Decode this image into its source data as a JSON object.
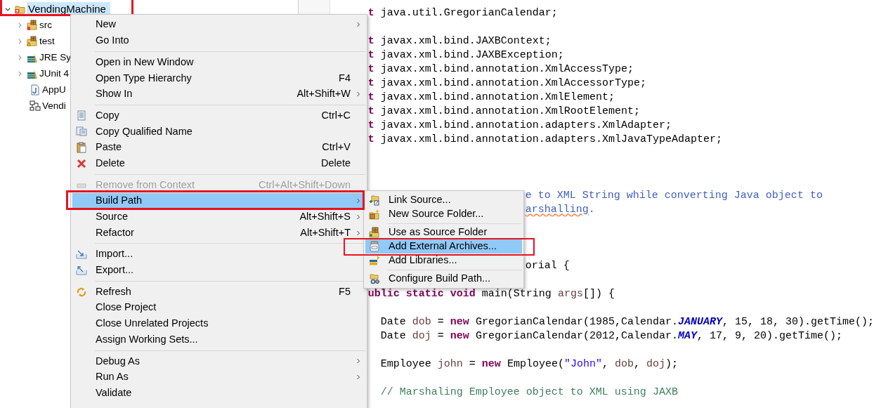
{
  "tree": [
    {
      "label": "VendingMachine",
      "expanded": true,
      "selected": true,
      "children": [
        {
          "label": "src",
          "expandable": true,
          "selected": false
        },
        {
          "label": "test",
          "expandable": true,
          "selected": false
        },
        {
          "label": "JRE Sy",
          "expandable": true,
          "selected": false
        },
        {
          "label": "JUnit 4",
          "expandable": true,
          "selected": false
        },
        {
          "label": "AppU",
          "expandable": false,
          "selected": false
        },
        {
          "label": "Vendi",
          "expandable": false,
          "selected": false
        }
      ]
    }
  ],
  "editor": {
    "lines": [
      {
        "kind": "code",
        "indented": false,
        "segments": [
          {
            "text": "t",
            "kind": "keyword"
          },
          {
            "text": " java.util.GregorianCalendar;",
            "kind": "plain"
          }
        ]
      },
      {
        "kind": "blank"
      },
      {
        "kind": "code",
        "indented": false,
        "segments": [
          {
            "text": "t",
            "kind": "keyword"
          },
          {
            "text": " javax.xml.bind.JAXBContext;",
            "kind": "plain"
          }
        ]
      },
      {
        "kind": "code",
        "indented": false,
        "segments": [
          {
            "text": "t",
            "kind": "keyword"
          },
          {
            "text": " javax.xml.bind.JAXBException;",
            "kind": "plain"
          }
        ]
      },
      {
        "kind": "code",
        "indented": false,
        "segments": [
          {
            "text": "t",
            "kind": "keyword"
          },
          {
            "text": " javax.xml.bind.annotation.XmlAccessType;",
            "kind": "plain"
          }
        ]
      },
      {
        "kind": "code",
        "indented": false,
        "segments": [
          {
            "text": "t",
            "kind": "keyword"
          },
          {
            "text": " javax.xml.bind.annotation.XmlAccessorType;",
            "kind": "plain"
          }
        ]
      },
      {
        "kind": "code",
        "indented": false,
        "segments": [
          {
            "text": "t",
            "kind": "keyword"
          },
          {
            "text": " javax.xml.bind.annotation.XmlElement;",
            "kind": "plain"
          }
        ]
      },
      {
        "kind": "code",
        "indented": false,
        "segments": [
          {
            "text": "t",
            "kind": "keyword"
          },
          {
            "text": " javax.xml.bind.annotation.XmlRootElement;",
            "kind": "plain"
          }
        ]
      },
      {
        "kind": "code",
        "indented": false,
        "segments": [
          {
            "text": "t",
            "kind": "keyword"
          },
          {
            "text": " javax.xml.bind.annotation.adapters.XmlAdapter;",
            "kind": "plain"
          }
        ]
      },
      {
        "kind": "code",
        "indented": false,
        "segments": [
          {
            "text": "t",
            "kind": "keyword"
          },
          {
            "text": " javax.xml.bind.annotation.adapters.XmlJavaTypeAdapter;",
            "kind": "plain"
          }
        ]
      },
      {
        "kind": "blank"
      },
      {
        "kind": "blank"
      },
      {
        "kind": "blank"
      },
      {
        "kind": "tail",
        "indented": false,
        "segments": [
          {
            "text": "e to XML String while converting Java object to",
            "kind": "doc"
          }
        ]
      },
      {
        "kind": "tail",
        "indented": false,
        "segments": [
          {
            "text": "arshalling",
            "kind": "misspelled"
          },
          {
            "text": ".",
            "kind": "doc"
          }
        ]
      },
      {
        "kind": "blank"
      },
      {
        "kind": "blank"
      },
      {
        "kind": "blank"
      },
      {
        "kind": "tail",
        "indented": false,
        "segments": [
          {
            "text": "orial {",
            "kind": "plain"
          }
        ]
      },
      {
        "kind": "blank"
      },
      {
        "kind": "code",
        "indented": false,
        "segments": [
          {
            "text": "ublic static void",
            "kind": "keyword"
          },
          {
            "text": " main(String ",
            "kind": "plain"
          },
          {
            "text": "args",
            "kind": "variable"
          },
          {
            "text": "[]) {",
            "kind": "plain"
          }
        ]
      },
      {
        "kind": "blank"
      },
      {
        "kind": "code",
        "indented": true,
        "segments": [
          {
            "text": "Date ",
            "kind": "plain"
          },
          {
            "text": "dob",
            "kind": "variable"
          },
          {
            "text": " = ",
            "kind": "plain"
          },
          {
            "text": "new",
            "kind": "keyword"
          },
          {
            "text": " GregorianCalendar(1985,Calendar.",
            "kind": "plain"
          },
          {
            "text": "JANUARY",
            "kind": "constant"
          },
          {
            "text": ", 15, 18, 30).getTime();",
            "kind": "plain"
          }
        ]
      },
      {
        "kind": "code",
        "indented": true,
        "segments": [
          {
            "text": "Date ",
            "kind": "plain"
          },
          {
            "text": "doj",
            "kind": "variable"
          },
          {
            "text": " = ",
            "kind": "plain"
          },
          {
            "text": "new",
            "kind": "keyword"
          },
          {
            "text": " GregorianCalendar(2012,Calendar.",
            "kind": "plain"
          },
          {
            "text": "MAY",
            "kind": "constant"
          },
          {
            "text": ", 17, 9, 20).getTime();",
            "kind": "plain"
          }
        ]
      },
      {
        "kind": "blank"
      },
      {
        "kind": "code",
        "indented": true,
        "segments": [
          {
            "text": "Employee ",
            "kind": "plain"
          },
          {
            "text": "john",
            "kind": "variable"
          },
          {
            "text": " = ",
            "kind": "plain"
          },
          {
            "text": "new",
            "kind": "keyword"
          },
          {
            "text": " Employee(",
            "kind": "plain"
          },
          {
            "text": "\"John\"",
            "kind": "string"
          },
          {
            "text": ", ",
            "kind": "plain"
          },
          {
            "text": "dob",
            "kind": "variable"
          },
          {
            "text": ", ",
            "kind": "plain"
          },
          {
            "text": "doj",
            "kind": "variable"
          },
          {
            "text": ");",
            "kind": "plain"
          }
        ]
      },
      {
        "kind": "blank"
      },
      {
        "kind": "code",
        "indented": true,
        "segments": [
          {
            "text": "// Marshaling Employee object to XML using JAXB",
            "kind": "comment"
          }
        ]
      }
    ]
  },
  "context_menu": [
    {
      "kind": "item",
      "label": "New",
      "submenu": true,
      "selected": false,
      "disabled": false
    },
    {
      "kind": "item",
      "label": "Go Into",
      "submenu": false,
      "selected": false,
      "disabled": false
    },
    {
      "kind": "separator"
    },
    {
      "kind": "item",
      "label": "Open in New Window",
      "submenu": false,
      "selected": false,
      "disabled": false
    },
    {
      "kind": "item",
      "label": "Open Type Hierarchy",
      "shortcut": "F4",
      "submenu": false,
      "selected": false,
      "disabled": false
    },
    {
      "kind": "item",
      "label": "Show In",
      "shortcut": "Alt+Shift+W",
      "submenu": true,
      "selected": false,
      "disabled": false
    },
    {
      "kind": "separator"
    },
    {
      "kind": "item",
      "label": "Copy",
      "shortcut": "Ctrl+C",
      "submenu": false,
      "selected": false,
      "disabled": false
    },
    {
      "kind": "item",
      "label": "Copy Qualified Name",
      "submenu": false,
      "selected": false,
      "disabled": false
    },
    {
      "kind": "item",
      "label": "Paste",
      "shortcut": "Ctrl+V",
      "submenu": false,
      "selected": false,
      "disabled": false
    },
    {
      "kind": "item",
      "label": "Delete",
      "shortcut": "Delete",
      "submenu": false,
      "selected": false,
      "disabled": false
    },
    {
      "kind": "separator"
    },
    {
      "kind": "item",
      "label": "Remove from Context",
      "shortcut": "Ctrl+Alt+Shift+Down",
      "submenu": false,
      "selected": false,
      "disabled": true
    },
    {
      "kind": "item",
      "label": "Build Path",
      "submenu": true,
      "selected": true,
      "disabled": false
    },
    {
      "kind": "item",
      "label": "Source",
      "shortcut": "Alt+Shift+S",
      "submenu": true,
      "selected": false,
      "disabled": false
    },
    {
      "kind": "item",
      "label": "Refactor",
      "shortcut": "Alt+Shift+T",
      "submenu": true,
      "selected": false,
      "disabled": false
    },
    {
      "kind": "separator"
    },
    {
      "kind": "item",
      "label": "Import...",
      "submenu": false,
      "selected": false,
      "disabled": false
    },
    {
      "kind": "item",
      "label": "Export...",
      "submenu": false,
      "selected": false,
      "disabled": false
    },
    {
      "kind": "separator"
    },
    {
      "kind": "item",
      "label": "Refresh",
      "shortcut": "F5",
      "submenu": false,
      "selected": false,
      "disabled": false
    },
    {
      "kind": "item",
      "label": "Close Project",
      "submenu": false,
      "selected": false,
      "disabled": false
    },
    {
      "kind": "item",
      "label": "Close Unrelated Projects",
      "submenu": false,
      "selected": false,
      "disabled": false
    },
    {
      "kind": "item",
      "label": "Assign Working Sets...",
      "submenu": false,
      "selected": false,
      "disabled": false
    },
    {
      "kind": "separator"
    },
    {
      "kind": "item",
      "label": "Debug As",
      "submenu": true,
      "selected": false,
      "disabled": false
    },
    {
      "kind": "item",
      "label": "Run As",
      "submenu": true,
      "selected": false,
      "disabled": false
    },
    {
      "kind": "item",
      "label": "Validate",
      "submenu": false,
      "selected": false,
      "disabled": false
    }
  ],
  "build_path_submenu": [
    {
      "kind": "item",
      "label": "Link Source...",
      "selected": false
    },
    {
      "kind": "item",
      "label": "New Source Folder...",
      "selected": false
    },
    {
      "kind": "separator"
    },
    {
      "kind": "item",
      "label": "Use as Source Folder",
      "selected": false
    },
    {
      "kind": "item",
      "label": "Add External Archives...",
      "selected": true
    },
    {
      "kind": "item",
      "label": "Add Libraries...",
      "selected": false
    },
    {
      "kind": "separator"
    },
    {
      "kind": "item",
      "label": "Configure Build Path...",
      "selected": false
    }
  ]
}
